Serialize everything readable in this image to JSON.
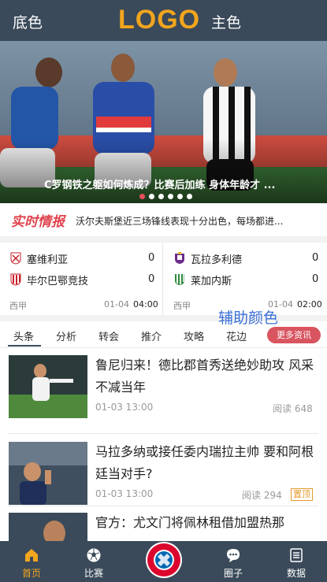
{
  "header": {
    "left_label": "底色",
    "logo": "LOGO",
    "right_label": "主色"
  },
  "banner": {
    "caption": "C罗钢铁之躯如何炼成？比赛后加练 身体年龄才 ...",
    "dot_count": 6,
    "active_dot": 0
  },
  "news_strip": {
    "tag": "实时情报",
    "text": "沃尔夫斯堡近三场锋线表现十分出色，每场都进..."
  },
  "matches": [
    {
      "home": "塞维利亚",
      "home_score": "0",
      "away": "毕尔巴鄂竞技",
      "away_score": "0",
      "league": "西甲",
      "date": "01-04",
      "time": "04:00"
    },
    {
      "home": "瓦拉多利德",
      "home_score": "0",
      "away": "莱加内斯",
      "away_score": "0",
      "league": "西甲",
      "date": "01-04",
      "time": "02:00"
    }
  ],
  "aux_label": "辅助颜色",
  "tabs": [
    "头条",
    "分析",
    "转会",
    "推介",
    "攻略",
    "花边"
  ],
  "more_button": "更多资讯",
  "articles": [
    {
      "title": "鲁尼归来！德比郡首秀送绝妙助攻 风采不减当年",
      "date": "01-03 13:00",
      "reads": "阅读 648",
      "badge": ""
    },
    {
      "title": "马拉多纳或接任委内瑞拉主帅 要和阿根廷当对手?",
      "date": "01-03 13:00",
      "reads": "阅读 294",
      "badge": "置顶"
    },
    {
      "title": "官方：尤文门将佩林租借加盟热那",
      "date": "",
      "reads": "",
      "badge": ""
    }
  ],
  "bottom_nav": {
    "items": [
      {
        "label": "首页",
        "icon": "home-icon"
      },
      {
        "label": "比赛",
        "icon": "soccer-ball-icon"
      },
      {
        "label": "",
        "icon": "club-crest-icon"
      },
      {
        "label": "圈子",
        "icon": "chat-bubble-icon"
      },
      {
        "label": "数据",
        "icon": "data-list-icon"
      }
    ],
    "crest_text": "FC BAYERN MÜNCHEN"
  },
  "colors": {
    "primary": "#3a4a5a",
    "accent": "#f2a51d",
    "highlight": "#e0444e",
    "auxiliary": "#3a6fd8"
  }
}
